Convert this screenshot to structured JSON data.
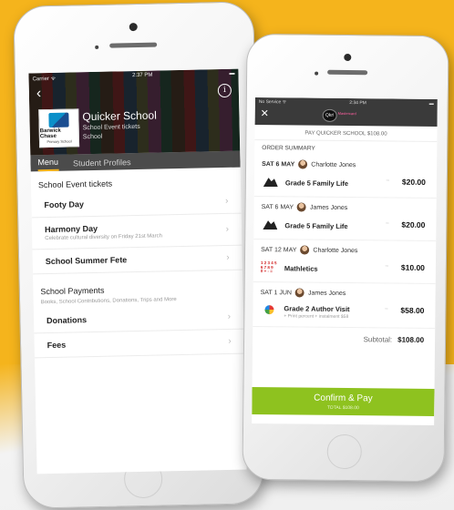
{
  "left_screen": {
    "status": {
      "carrier": "Carrier ᯤ",
      "time": "2:37 PM",
      "battery": "▬"
    },
    "school": {
      "name": "Quicker School",
      "sub1": "School Event tickets",
      "sub2": "School",
      "logo_text": "Barwick Chase",
      "logo_sub": "Primary School"
    },
    "tabs": [
      {
        "label": "Menu"
      },
      {
        "label": "Student Profiles"
      }
    ],
    "sections": {
      "events_title": "School Event tickets",
      "payments_title": "School Payments",
      "payments_desc": "Books, School Contributions, Donations, Trips and More"
    },
    "event_items": [
      {
        "label": "Footy Day",
        "desc": ""
      },
      {
        "label": "Harmony Day",
        "desc": "Celebrate cultural diversity on Friday 21st March"
      },
      {
        "label": "School Summer Fete",
        "desc": ""
      }
    ],
    "payment_items": [
      {
        "label": "Donations"
      },
      {
        "label": "Fees"
      }
    ]
  },
  "right_screen": {
    "status": {
      "carrier": "No Service ᯤ",
      "time": "2:34 PM",
      "battery": "▬"
    },
    "brand": "Qkr!",
    "brand_badge": "Mastercard",
    "pay_header": "PAY QUICKER SCHOOL $108.00",
    "order_summary": "ORDER SUMMARY",
    "groups": [
      {
        "date": "SAT 6 MAY",
        "person": "Charlotte Jones",
        "item": {
          "title": "Grade 5 Family Life",
          "sub": "",
          "price": "$20.00"
        }
      },
      {
        "date": "SAT 6 MAY",
        "person": "James Jones",
        "item": {
          "title": "Grade 5 Family Life",
          "sub": "",
          "price": "$20.00"
        }
      },
      {
        "date": "SAT 12 MAY",
        "person": "Charlotte Jones",
        "item": {
          "title": "Mathletics",
          "sub": "",
          "price": "$10.00"
        }
      },
      {
        "date": "SAT 1 JUN",
        "person": "James Jones",
        "item": {
          "title": "Grade 2 Author Visit",
          "sub": "+ Print percent + instalment $58",
          "price": "$58.00"
        }
      }
    ],
    "subtotal_label": "Subtotal:",
    "subtotal_value": "$108.00",
    "confirm_label": "Confirm & Pay",
    "confirm_sub": "TOTAL $108.00",
    "colors": {
      "confirm": "#8ec21f",
      "topbar": "#3a3a3a"
    }
  },
  "background": {
    "accent": "#f5b41c"
  }
}
